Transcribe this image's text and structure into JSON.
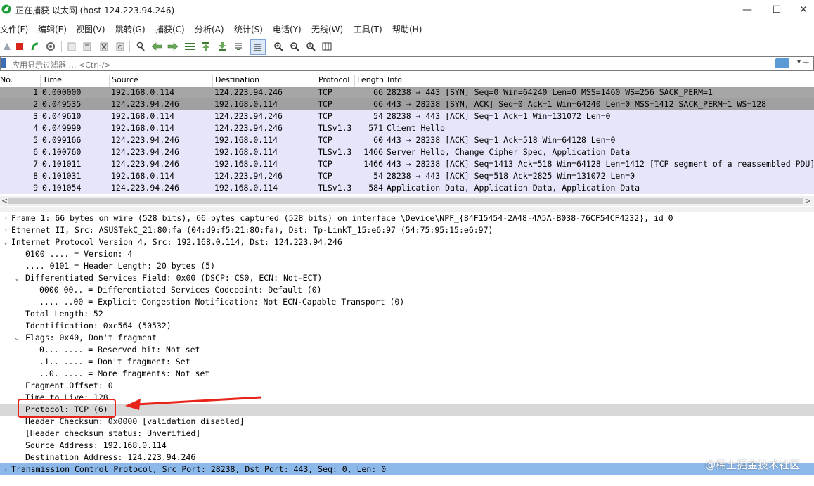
{
  "window": {
    "title": "正在捕获 以太网 (host 124.223.94.246)",
    "controls": [
      "—",
      "☐",
      "✕"
    ]
  },
  "menu": [
    "文件(F)",
    "编辑(E)",
    "视图(V)",
    "跳转(G)",
    "捕获(C)",
    "分析(A)",
    "统计(S)",
    "电话(Y)",
    "无线(W)",
    "工具(T)",
    "帮助(H)"
  ],
  "filter": {
    "placeholder": "应用显示过滤器 … <Ctrl-/>"
  },
  "packet_list": {
    "columns": [
      "No.",
      "Time",
      "Source",
      "Destination",
      "Protocol",
      "Length",
      "Info"
    ],
    "rows": [
      {
        "no": "1",
        "time": "0.000000",
        "src": "192.168.0.114",
        "dst": "124.223.94.246",
        "proto": "TCP",
        "len": "66",
        "info": "28238 → 443 [SYN] Seq=0 Win=64240 Len=0 MSS=1460 WS=256 SACK_PERM=1"
      },
      {
        "no": "2",
        "time": "0.049535",
        "src": "124.223.94.246",
        "dst": "192.168.0.114",
        "proto": "TCP",
        "len": "66",
        "info": "443 → 28238 [SYN, ACK] Seq=0 Ack=1 Win=64240 Len=0 MSS=1412 SACK_PERM=1 WS=128"
      },
      {
        "no": "3",
        "time": "0.049610",
        "src": "192.168.0.114",
        "dst": "124.223.94.246",
        "proto": "TCP",
        "len": "54",
        "info": "28238 → 443 [ACK] Seq=1 Ack=1 Win=131072 Len=0"
      },
      {
        "no": "4",
        "time": "0.049999",
        "src": "192.168.0.114",
        "dst": "124.223.94.246",
        "proto": "TLSv1.3",
        "len": "571",
        "info": "Client Hello"
      },
      {
        "no": "5",
        "time": "0.099166",
        "src": "124.223.94.246",
        "dst": "192.168.0.114",
        "proto": "TCP",
        "len": "60",
        "info": "443 → 28238 [ACK] Seq=1 Ack=518 Win=64128 Len=0"
      },
      {
        "no": "6",
        "time": "0.100760",
        "src": "124.223.94.246",
        "dst": "192.168.0.114",
        "proto": "TLSv1.3",
        "len": "1466",
        "info": "Server Hello, Change Cipher Spec, Application Data"
      },
      {
        "no": "7",
        "time": "0.101011",
        "src": "124.223.94.246",
        "dst": "192.168.0.114",
        "proto": "TCP",
        "len": "1466",
        "info": "443 → 28238 [ACK] Seq=1413 Ack=518 Win=64128 Len=1412 [TCP segment of a reassembled PDU]"
      },
      {
        "no": "8",
        "time": "0.101031",
        "src": "192.168.0.114",
        "dst": "124.223.94.246",
        "proto": "TCP",
        "len": "54",
        "info": "28238 → 443 [ACK] Seq=518 Ack=2825 Win=131072 Len=0"
      },
      {
        "no": "9",
        "time": "0.101054",
        "src": "124.223.94.246",
        "dst": "192.168.0.114",
        "proto": "TLSv1.3",
        "len": "584",
        "info": "Application Data, Application Data, Application Data"
      }
    ]
  },
  "details": {
    "lines": [
      {
        "text": "Frame 1: 66 bytes on wire (528 bits), 66 bytes captured (528 bits) on interface \\Device\\NPF_{84F15454-2A48-4A5A-B038-76CF54CF4232}, id 0",
        "level": 0,
        "expander": ">"
      },
      {
        "text": "Ethernet II, Src: ASUSTekC_21:80:fa (04:d9:f5:21:80:fa), Dst: Tp-LinkT_15:e6:97 (54:75:95:15:e6:97)",
        "level": 0,
        "expander": ">"
      },
      {
        "text": "Internet Protocol Version 4, Src: 192.168.0.114, Dst: 124.223.94.246",
        "level": 0,
        "expander": "v"
      },
      {
        "text": "0100 .... = Version: 4",
        "level": 1,
        "expander": ""
      },
      {
        "text": ".... 0101 = Header Length: 20 bytes (5)",
        "level": 1,
        "expander": ""
      },
      {
        "text": "Differentiated Services Field: 0x00 (DSCP: CS0, ECN: Not-ECT)",
        "level": 1,
        "expander": "v"
      },
      {
        "text": "0000 00.. = Differentiated Services Codepoint: Default (0)",
        "level": 2,
        "expander": ""
      },
      {
        "text": ".... ..00 = Explicit Congestion Notification: Not ECN-Capable Transport (0)",
        "level": 2,
        "expander": ""
      },
      {
        "text": "Total Length: 52",
        "level": 1,
        "expander": ""
      },
      {
        "text": "Identification: 0xc564 (50532)",
        "level": 1,
        "expander": ""
      },
      {
        "text": "Flags: 0x40, Don't fragment",
        "level": 1,
        "expander": "v"
      },
      {
        "text": "0... .... = Reserved bit: Not set",
        "level": 2,
        "expander": ""
      },
      {
        "text": ".1.. .... = Don't fragment: Set",
        "level": 2,
        "expander": ""
      },
      {
        "text": "..0. .... = More fragments: Not set",
        "level": 2,
        "expander": ""
      },
      {
        "text": "Fragment Offset: 0",
        "level": 1,
        "expander": ""
      },
      {
        "text": "Time to Live: 128",
        "level": 1,
        "expander": ""
      },
      {
        "text": "Protocol: TCP (6)",
        "level": 1,
        "expander": "",
        "selected": true
      },
      {
        "text": "Header Checksum: 0x0000 [validation disabled]",
        "level": 1,
        "expander": ""
      },
      {
        "text": "[Header checksum status: Unverified]",
        "level": 1,
        "expander": ""
      },
      {
        "text": "Source Address: 192.168.0.114",
        "level": 1,
        "expander": ""
      },
      {
        "text": "Destination Address: 124.223.94.246",
        "level": 1,
        "expander": ""
      },
      {
        "text": "Transmission Control Protocol, Src Port: 28238, Dst Port: 443, Seq: 0, Len: 0",
        "level": 0,
        "expander": ">",
        "tcp": true
      }
    ]
  },
  "watermark": "@稀土掘金技术社区",
  "colors": {
    "row_selected": "#a6a6a6",
    "row_syn": "#a0a0a0",
    "row_normal": "#e6e5f9",
    "tcp_line": "#8db9ea",
    "selected_line": "#d8d8d8",
    "annotation_red": "#e8231a"
  }
}
